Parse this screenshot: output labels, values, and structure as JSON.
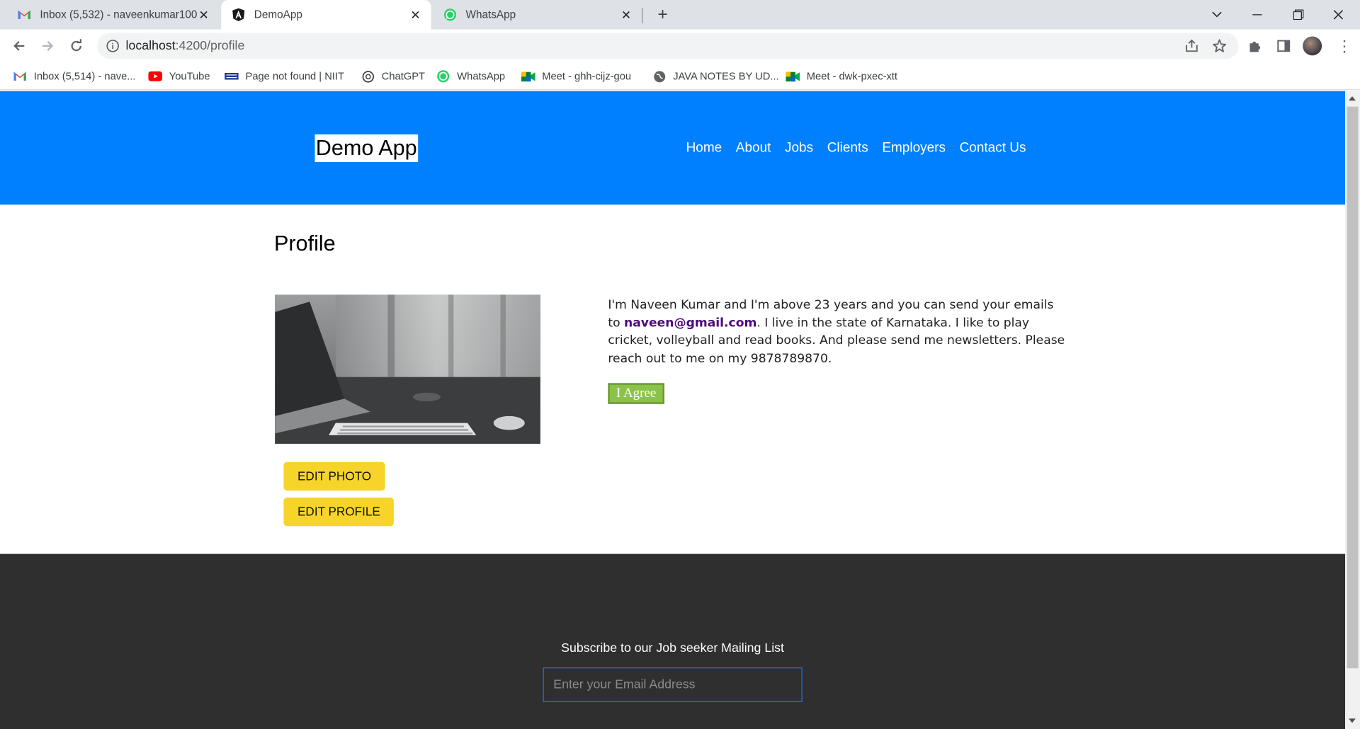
{
  "browser": {
    "tabs": [
      {
        "title": "Inbox (5,532) - naveenkumar100",
        "icon": "gmail-icon",
        "active": false
      },
      {
        "title": "DemoApp",
        "icon": "angular-icon",
        "active": true
      },
      {
        "title": "WhatsApp",
        "icon": "whatsapp-icon",
        "active": false
      }
    ],
    "url_host": "localhost",
    "url_rest": ":4200/profile",
    "bookmarks": [
      {
        "label": "Inbox (5,514) - nave...",
        "icon": "gmail-icon"
      },
      {
        "label": "YouTube",
        "icon": "youtube-icon"
      },
      {
        "label": "Page not found | NIIT",
        "icon": "niit-icon"
      },
      {
        "label": "ChatGPT",
        "icon": "chatgpt-icon"
      },
      {
        "label": "WhatsApp",
        "icon": "whatsapp-icon"
      },
      {
        "label": "Meet - ghh-cijz-gou",
        "icon": "meet-icon"
      },
      {
        "label": "JAVA NOTES BY UD...",
        "icon": "globe-icon"
      },
      {
        "label": "Meet - dwk-pxec-xtt",
        "icon": "meet-icon"
      }
    ]
  },
  "site": {
    "brand": "Demo App",
    "nav": [
      "Home",
      "About",
      "Jobs",
      "Clients",
      "Employers",
      "Contact Us"
    ]
  },
  "profile": {
    "title": "Profile",
    "bio_before": "I'm Naveen Kumar and I'm above 23 years and you can send your emails to ",
    "email": "naveen@gmail.com",
    "bio_after": ". I live in the state of Karnataka. I like to play cricket, volleyball and read books. And please send me newsletters. Please reach out to me on my 9878789870.",
    "agree_label": "I Agree",
    "edit_photo_label": "EDIT PHOTO",
    "edit_profile_label": "EDIT PROFILE"
  },
  "footer": {
    "subscribe_title": "Subscribe to our Job seeker Mailing List",
    "email_placeholder": "Enter your Email Address"
  },
  "colors": {
    "header_blue": "#0080ff",
    "button_yellow": "#f7d42a",
    "agree_green": "#8bc34a",
    "footer_dark": "#2f2f2f"
  }
}
